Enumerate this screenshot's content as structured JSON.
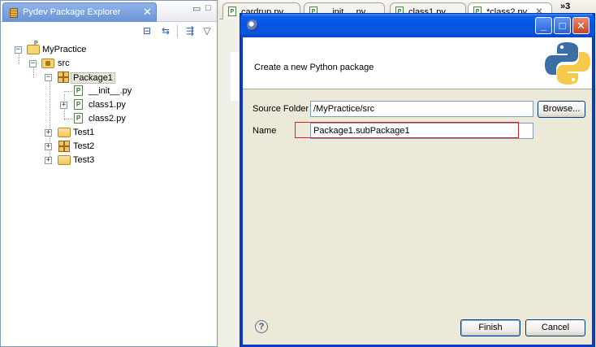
{
  "explorer": {
    "title": "Pydev Package Explorer",
    "tree": [
      {
        "label": "MyPractice",
        "icon": "project-icon"
      },
      {
        "label": "src",
        "icon": "source-folder-icon"
      },
      {
        "label": "Package1",
        "icon": "package-icon"
      },
      {
        "label": "__init__.py",
        "icon": "python-file-icon"
      },
      {
        "label": "class1.py",
        "icon": "python-file-icon"
      },
      {
        "label": "class2.py",
        "icon": "python-file-icon"
      },
      {
        "label": "Test1",
        "icon": "folder-icon"
      },
      {
        "label": "Test2",
        "icon": "package-icon"
      },
      {
        "label": "Test3",
        "icon": "folder-icon"
      }
    ]
  },
  "editor": {
    "tabs": [
      {
        "label": "cardrup.py"
      },
      {
        "label": "__init__.py"
      },
      {
        "label": "class1.py"
      },
      {
        "label": "*class2.py"
      }
    ],
    "more_tabs": "»3"
  },
  "dialog": {
    "message": "Create a new Python package",
    "source_folder_label": "Source Folder",
    "source_folder_value": "/MyPractice/src",
    "browse_label": "Browse...",
    "name_label": "Name",
    "name_value": "Package1.subPackage1",
    "help_symbol": "?",
    "finish_label": "Finish",
    "cancel_label": "Cancel"
  },
  "colors": {
    "titlebar": "#0554e3",
    "highlight": "#d42020",
    "python_blue": "#3a6ea5",
    "python_yellow": "#f7c94b"
  }
}
